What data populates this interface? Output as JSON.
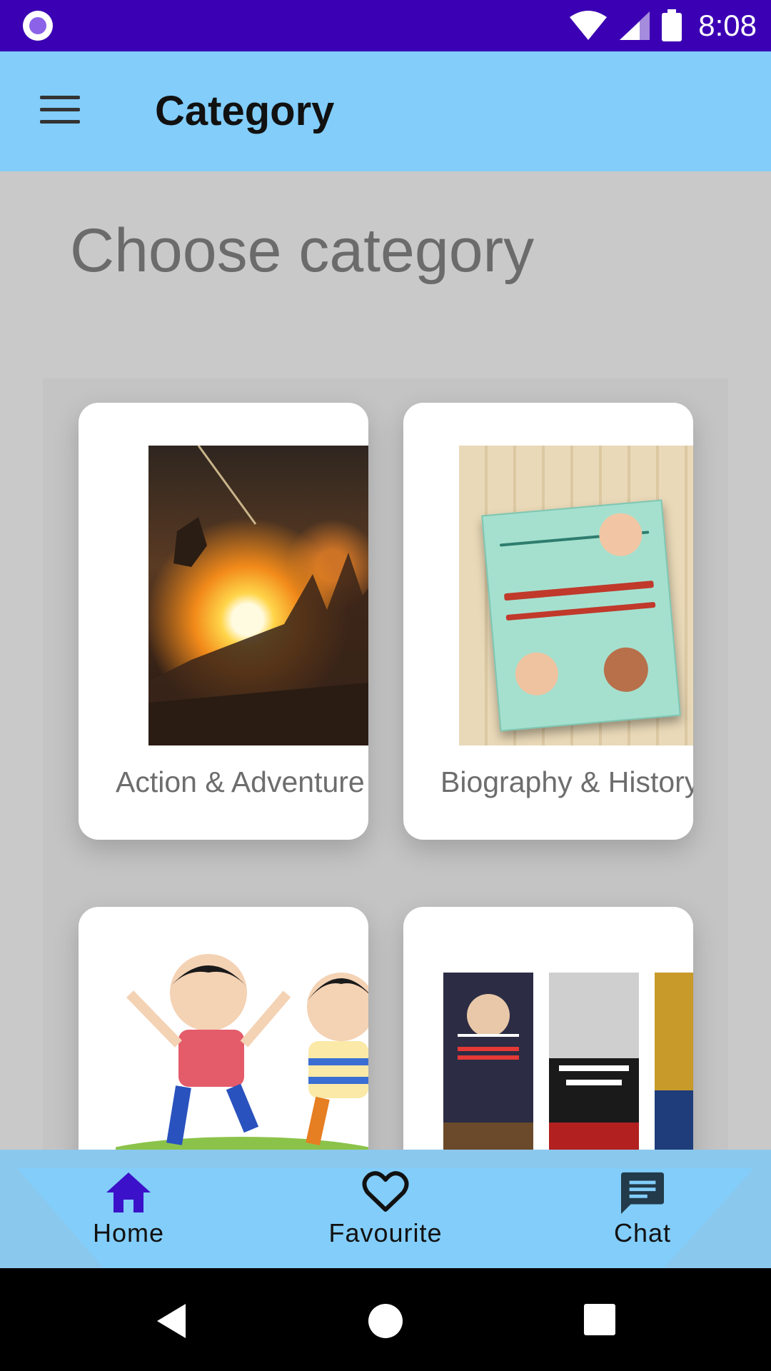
{
  "status_bar": {
    "time": "8:08"
  },
  "app_bar": {
    "title": "Category"
  },
  "content": {
    "heading": "Choose category"
  },
  "categories": [
    {
      "label": "Action & Adventure",
      "image": "action-adventure-image"
    },
    {
      "label": "Biography & History",
      "image": "biography-history-image"
    },
    {
      "label": "",
      "image": "kids-image"
    },
    {
      "label": "",
      "image": "documentary-films-image"
    }
  ],
  "bottom_nav": {
    "items": [
      {
        "label": "Home",
        "icon": "home-icon",
        "active": true
      },
      {
        "label": "Favourite",
        "icon": "heart-icon",
        "active": false
      },
      {
        "label": "Chat",
        "icon": "chat-icon",
        "active": false
      }
    ]
  },
  "colors": {
    "status_bar": "#3b00b3",
    "app_bar": "#82cdfa",
    "active_icon": "#3b12c9",
    "page_bg": "#c9c9c9"
  }
}
